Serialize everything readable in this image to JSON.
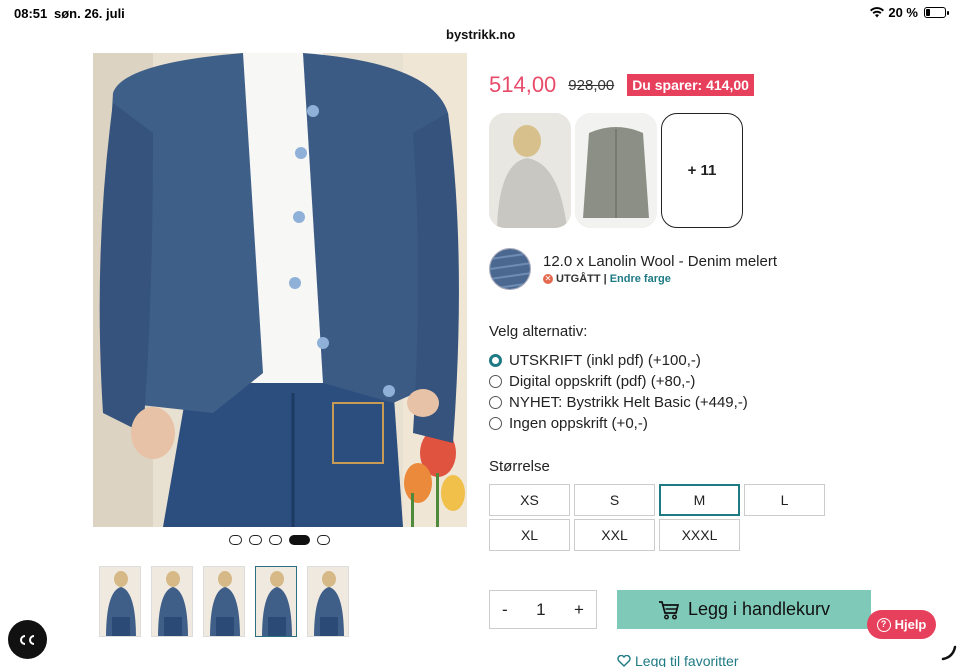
{
  "status_bar": {
    "time": "08:51",
    "date": "søn. 26. juli",
    "battery": "20 %",
    "battery_level": 0.2
  },
  "browser": {
    "url": "bystrikk.no"
  },
  "gallery": {
    "dots_count": 5,
    "active_dot": 3,
    "thumb_count": 5,
    "active_thumb": 3
  },
  "price": {
    "current": "514,00",
    "original": "928,00",
    "savings": "Du sparer: 414,00"
  },
  "color_thumbs": {
    "more": "+ 11"
  },
  "yarn": {
    "name": "12.0 x Lanolin Wool - Denim melert",
    "status": "UTGÅTT",
    "separator": "|",
    "change_color": "Endre farge"
  },
  "options": {
    "title": "Velg alternativ:",
    "items": [
      {
        "label": "UTSKRIFT (inkl pdf) (+100,-)",
        "checked": true
      },
      {
        "label": "Digital oppskrift (pdf) (+80,-)",
        "checked": false
      },
      {
        "label": "NYHET: Bystrikk Helt Basic (+449,-)",
        "checked": false
      },
      {
        "label": "Ingen oppskrift (+0,-)",
        "checked": false
      }
    ]
  },
  "sizes": {
    "title": "Størrelse",
    "items": [
      "XS",
      "S",
      "M",
      "L",
      "XL",
      "XXL",
      "XXXL"
    ],
    "selected": "M"
  },
  "cart": {
    "minus": "-",
    "quantity": "1",
    "plus": "+",
    "add_label": "Legg i handlekurv"
  },
  "favorite": {
    "label": "Legg til favoritter"
  },
  "help": {
    "label": "Hjelp"
  },
  "colors": {
    "accent": "#1e7a84",
    "sale": "#e7405c",
    "cart": "#7ec9b8"
  }
}
